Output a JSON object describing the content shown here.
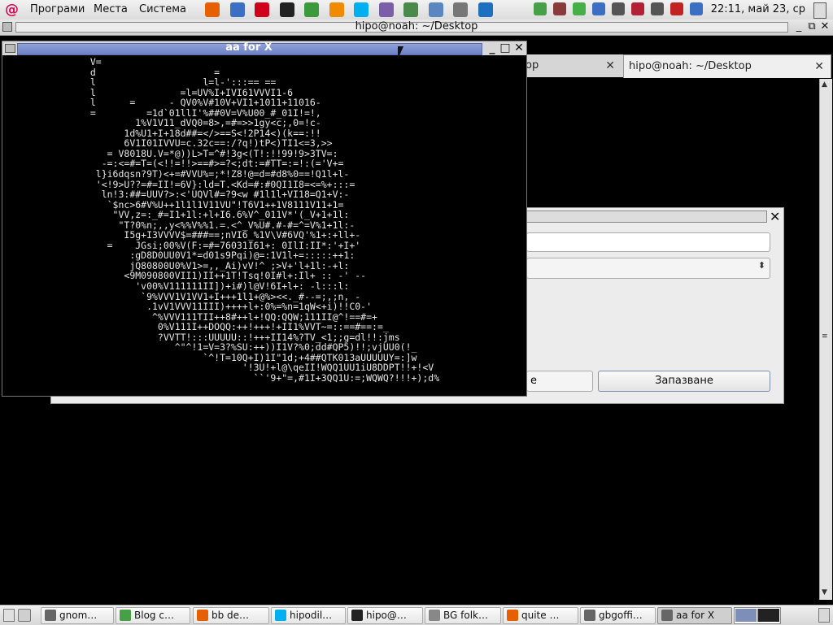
{
  "top_panel": {
    "menus": [
      "Програми",
      "Места",
      "Система"
    ],
    "clock": "22:11, май 23, ср",
    "launchers": [
      {
        "icon": "firefox-icon",
        "color": "#e66000"
      },
      {
        "icon": "globe-icon",
        "color": "#3a6fc4"
      },
      {
        "icon": "opera-icon",
        "color": "#d0021b"
      },
      {
        "icon": "terminal-icon",
        "color": "#222222"
      },
      {
        "icon": "network-icon",
        "color": "#3c9a3c"
      },
      {
        "icon": "vlc-icon",
        "color": "#f08a00"
      },
      {
        "icon": "skype-icon",
        "color": "#00aff0"
      },
      {
        "icon": "pidgin-icon",
        "color": "#7a5fa8"
      },
      {
        "icon": "box-icon",
        "color": "#4a8a4a"
      },
      {
        "icon": "disk-icon",
        "color": "#5c86c2"
      },
      {
        "icon": "trash-icon",
        "color": "#777777"
      },
      {
        "icon": "teamviewer-icon",
        "color": "#1d6fc0"
      }
    ],
    "tray": [
      {
        "icon": "chat-icon",
        "color": "#46a046"
      },
      {
        "icon": "briefcase-icon",
        "color": "#8a3a3a"
      },
      {
        "icon": "leaf-icon",
        "color": "#46b046"
      },
      {
        "icon": "bluetooth-icon",
        "color": "#3a6fc4"
      },
      {
        "icon": "network-icon",
        "color": "#555555"
      },
      {
        "icon": "flag-icon",
        "color": "#b22234"
      },
      {
        "icon": "volume-icon",
        "color": "#555555"
      },
      {
        "icon": "notification-icon",
        "color": "#c22222"
      },
      {
        "icon": "battery-icon",
        "color": "#3a6fc4"
      }
    ]
  },
  "terminal_window": {
    "title": "hipo@noah: ~/Desktop",
    "tabs": [
      {
        "label": "op",
        "active": false
      },
      {
        "label": "hipo@noah: ~/Desktop",
        "active": true
      }
    ]
  },
  "dialog": {
    "cancel_label": "е",
    "save_label": "Запазване"
  },
  "aa_window": {
    "title": "aa for X",
    "art_lines": [
      "               V=",
      "               d                     =",
      "               l                   l=l-':::== ==",
      "               l               =l=UV%I+IVI61VVVI1-6",
      "               l      =      - QV0%V#10V+VI1+1011+11016-",
      "               =         =1d`01llI'%##0V=V%U00_#_01I!=!,",
      "                       1%V1V11_dVQ0=8>,=#=>>1gy<c;,0=!c-",
      "                     1d%U1+I+18d##=</>==S<!2P14<)(k==:!!",
      "                     6V1I01IVVU=c.32c==:/?q!)tP<)TI1<=3,>>",
      "                  = V8018U.V=*@))L>T=^#!3g<(T!:!!99!9>3TV=:",
      "                 -=:<=#=T=(<!!=!!>==#>=?<;dt:=#TT=:=!:(='V+=",
      "                l}i6dqsn?9T)<+=#VVU%=;*!Z8!@=d=#d8%0==!Q1l+l-",
      "                '<!9>U??=#=II!=6V}:ld=T.<Kd=#:#0QI1I8=<=%+:::=",
      "                 ln!3:##=UUV?>:<'UQVl#=?9<w #1l1l+VI18=Q1+V:-",
      "                  `$nc>6#V%U++1l1l1V11VU\"!T6V1++1V8111V11+1=",
      "                   \"VV,z=:_#=I1+1l:+l+I6.6%V^_011V*'(_V+1+1l:",
      "                    \"T?0%n;,,y<%%V%%1.=.<^_V%U#.#-#=^=V%1+1l:-",
      "                     I5g+I3VVVV$=###==;nVI6_%1V\\V#6VQ'%1+:+ll+-",
      "                  =    JGsi;00%V(F:=#=76031I61+: 0IlI:II*:'+I+'",
      "                      :gD8D0UU0V1*=d01s9Pqi)@=:1V1l+=:::::++1:",
      "                      jQ80800U0%V1>=,,_Ai)vV!^ ;>V+'l+1l:-+l:",
      "                     <9M090800VII1)II++1T!Tsq!0I#l+:Il+ :: -' --",
      "                       'v00%V111111II])+i#)l@V!6I+l+: -l:::l:",
      "                        `9%VVV1V1VV1+I+++1l1+@%><<._#--=;,;n, -",
      "                         .1vV1VVV11III)++++l+:0%=%n=1qW<+i)!!C0-'",
      "                          ^%VVV111TII++8#++l+!QQ:QQW;111II@^!==#=+",
      "                           0%V111I++DOQQ:++!+++!+II1%VVT~=::==#==:=_",
      "                           ?VVTT!:::UUUUU::!+++II14%?TV_<1;;g=dl!!:jms",
      "                              ^\"^!1=V=3?%SU:++))I1V?%0;dd#QP5)!!;vjUU0(!_",
      "                                   `^!T=10Q+I)1I\"1d;+4##QTK013aUUUUUY=:]w",
      "                                          '!3U!+l@\\qeII!WQQ1UU1iU8DDPT!!+!<V",
      "                                            ``'9+\"=,#1I+3QQ1U:=;WQWQ?!!!+);d%"
    ]
  },
  "taskbar": {
    "tasks": [
      {
        "label": "gnom…",
        "icon": "screenshot-icon",
        "color": "#666666",
        "active": false
      },
      {
        "label": "Blog c…",
        "icon": "blog-icon",
        "color": "#46a046",
        "active": false
      },
      {
        "label": "bb de…",
        "icon": "firefox-icon",
        "color": "#e66000",
        "active": false
      },
      {
        "label": "hipodil…",
        "icon": "skype-icon",
        "color": "#00aff0",
        "active": false
      },
      {
        "label": "hipo@…",
        "icon": "terminal-icon",
        "color": "#222222",
        "active": false
      },
      {
        "label": "BG folk…",
        "icon": "document-icon",
        "color": "#888888",
        "active": false
      },
      {
        "label": "quite …",
        "icon": "firefox-icon",
        "color": "#e66000",
        "active": false
      },
      {
        "label": "gbgoffi…",
        "icon": "window-icon",
        "color": "#666666",
        "active": false
      },
      {
        "label": "aa for X",
        "icon": "window-icon",
        "color": "#666666",
        "active": true
      }
    ]
  }
}
